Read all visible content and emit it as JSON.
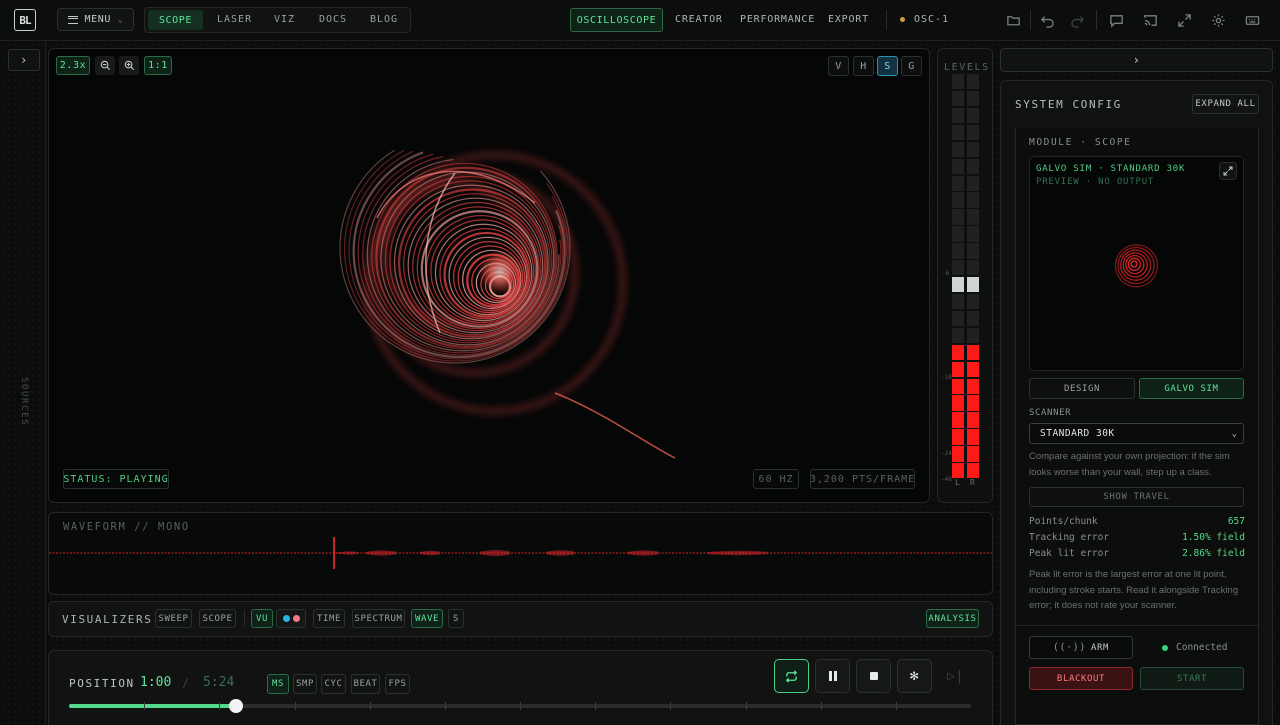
{
  "topbar": {
    "logo": "BL",
    "menu_label": "MENU",
    "nav": [
      "SCOPE",
      "LASER",
      "VIZ",
      "DOCS",
      "BLOG"
    ],
    "modes": [
      "OSCILLOSCOPE",
      "CREATOR",
      "PERFORMANCE",
      "EXPORT"
    ],
    "device": "OSC-1",
    "icons": [
      "folder-icon",
      "undo-icon",
      "redo-icon",
      "chat-icon",
      "cast-icon",
      "fullscreen-icon",
      "gear-icon",
      "keyboard-icon"
    ]
  },
  "left_rail": {
    "sources_label": "SOURCES"
  },
  "scope": {
    "zoom": "2.3x",
    "reset_label": "1:1",
    "view_toggles": [
      "V",
      "H",
      "S",
      "G"
    ],
    "active_toggle": "S",
    "status": "STATUS: PLAYING",
    "rate": "60 HZ",
    "points": "3,200 PTS/FRAME"
  },
  "levels": {
    "title": "LEVELS",
    "scale": [
      "-6",
      "-18",
      "-24",
      "-48"
    ],
    "channels": [
      "L",
      "R"
    ],
    "l_level": 0.35,
    "r_level": 0.35,
    "peak": 0.48
  },
  "waveform": {
    "title": "WAVEFORM // MONO"
  },
  "visualizers": {
    "title": "VISUALIZERS",
    "buttons": [
      "SWEEP",
      "SCOPE",
      "VU",
      "TIME",
      "SPECTRUM",
      "WAVE",
      "S"
    ],
    "active": [
      "VU",
      "WAVE"
    ],
    "analysis_label": "ANALYSIS",
    "dot_colors": [
      "#2bb3e6",
      "#f07a8a"
    ]
  },
  "transport": {
    "position_label": "POSITION",
    "current": "1:00",
    "divider": "/",
    "total": "5:24",
    "units": [
      "MS",
      "SMP",
      "CYC",
      "BEAT",
      "FPS"
    ],
    "active_unit": "MS",
    "progress": 0.185
  },
  "config": {
    "title": "SYSTEM CONFIG",
    "expand_label": "EXPAND ALL",
    "module_label": "MODULE · SCOPE",
    "preview_title": "GALVO SIM · STANDARD 30K",
    "preview_sub": "PREVIEW · NO OUTPUT",
    "tabs": [
      "DESIGN",
      "GALVO SIM"
    ],
    "active_tab": "GALVO SIM",
    "scanner_label": "SCANNER",
    "scanner_value": "STANDARD 30K",
    "scanner_note": "Compare against your own projection: if the sim looks worse than your wall, step up a class.",
    "travel_label": "SHOW TRAVEL",
    "stats": [
      {
        "label": "Points/chunk",
        "value": "657"
      },
      {
        "label": "Tracking error",
        "value": "1.50% field"
      },
      {
        "label": "Peak lit error",
        "value": "2.86% field"
      }
    ],
    "peak_note": "Peak lit error is the largest error at one lit point, including stroke starts. Read it alongside Tracking error; it does not rate your scanner.",
    "arm_label": "ARM",
    "connection": "Connected",
    "blackout_label": "BLACKOUT",
    "start_label": "START"
  },
  "colors": {
    "accent": "#54d98a",
    "laser": "#ff4a4a",
    "active_blue": "#2f8fb5"
  }
}
